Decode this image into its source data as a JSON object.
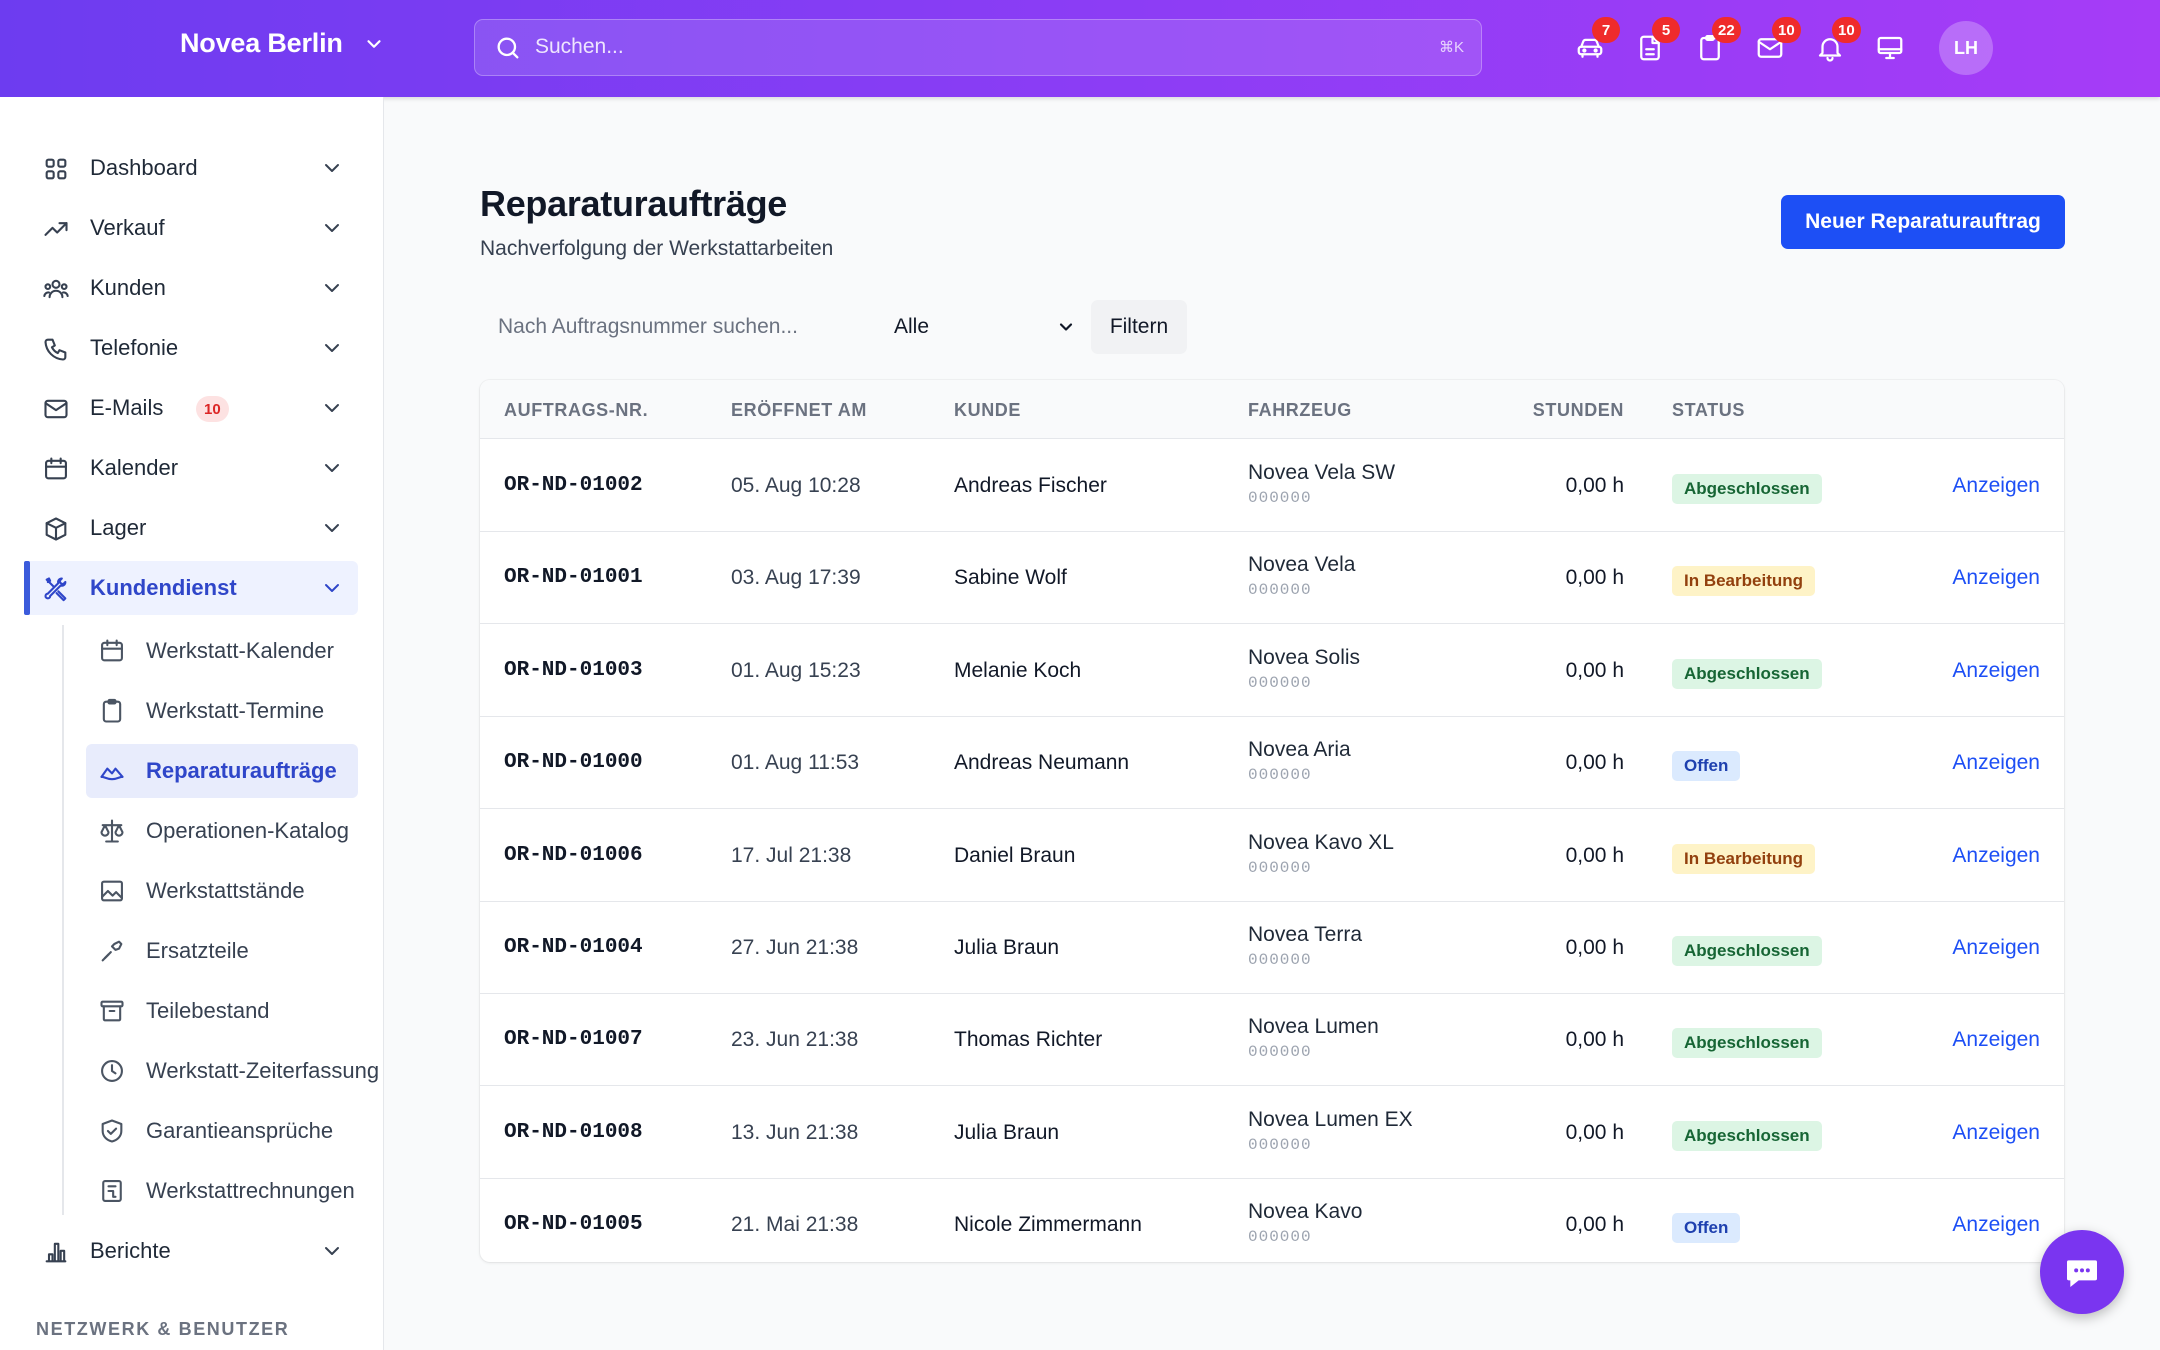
{
  "header": {
    "brand": "Novea Berlin",
    "search_placeholder": "Suchen...",
    "search_shortcut": "⌘K",
    "icons": [
      {
        "name": "car-icon",
        "badge": "7"
      },
      {
        "name": "document-icon",
        "badge": "5"
      },
      {
        "name": "clipboard-icon",
        "badge": "22"
      },
      {
        "name": "mail-icon",
        "badge": "10"
      },
      {
        "name": "bell-icon",
        "badge": "10"
      },
      {
        "name": "monitor-icon",
        "badge": ""
      }
    ],
    "avatar_initials": "LH"
  },
  "sidebar": {
    "items": [
      {
        "label": "Dashboard",
        "icon": "grid-icon"
      },
      {
        "label": "Verkauf",
        "icon": "trending-up-icon"
      },
      {
        "label": "Kunden",
        "icon": "users-icon"
      },
      {
        "label": "Telefonie",
        "icon": "phone-icon"
      },
      {
        "label": "E-Mails",
        "icon": "mail-icon",
        "badge": "10"
      },
      {
        "label": "Kalender",
        "icon": "calendar-icon"
      },
      {
        "label": "Lager",
        "icon": "box-icon"
      },
      {
        "label": "Kundendienst",
        "icon": "tools-icon",
        "active": true
      },
      {
        "label": "Berichte",
        "icon": "bar-chart-icon"
      }
    ],
    "subitems": [
      {
        "label": "Werkstatt-Kalender",
        "icon": "calendar-icon"
      },
      {
        "label": "Werkstatt-Termine",
        "icon": "clipboard-icon"
      },
      {
        "label": "Reparaturaufträge",
        "icon": "car-repair-icon",
        "active": true
      },
      {
        "label": "Operationen-Katalog",
        "icon": "scale-icon"
      },
      {
        "label": "Werkstattstände",
        "icon": "image-icon"
      },
      {
        "label": "Ersatzteile",
        "icon": "wrench-icon"
      },
      {
        "label": "Teilebestand",
        "icon": "archive-icon"
      },
      {
        "label": "Werkstatt-Zeiterfassung",
        "icon": "clock-icon"
      },
      {
        "label": "Garantieansprüche",
        "icon": "shield-icon"
      },
      {
        "label": "Werkstattrechnungen",
        "icon": "receipt-icon"
      }
    ],
    "section_title": "NETZWERK & BENUTZER"
  },
  "main": {
    "title": "Reparaturaufträge",
    "subtitle": "Nachverfolgung der Werkstattarbeiten",
    "new_button": "Neuer Reparaturauftrag",
    "filter": {
      "search_placeholder": "Nach Auftragsnummer suchen...",
      "select_value": "Alle",
      "button": "Filtern"
    },
    "table": {
      "columns": [
        "AUFTRAGS-NR.",
        "ERÖFFNET AM",
        "KUNDE",
        "FAHRZEUG",
        "STUNDEN",
        "STATUS"
      ],
      "action_label": "Anzeigen",
      "rows": [
        {
          "id": "OR-ND-01002",
          "opened": "05. Aug 10:28",
          "customer": "Andreas Fischer",
          "vehicle": "Novea Vela SW",
          "vin": "000000",
          "hours": "0,00 h",
          "status": "Abgeschlossen",
          "status_type": "done"
        },
        {
          "id": "OR-ND-01001",
          "opened": "03. Aug 17:39",
          "customer": "Sabine Wolf",
          "vehicle": "Novea Vela",
          "vin": "000000",
          "hours": "0,00 h",
          "status": "In Bearbeitung",
          "status_type": "prog"
        },
        {
          "id": "OR-ND-01003",
          "opened": "01. Aug 15:23",
          "customer": "Melanie Koch",
          "vehicle": "Novea Solis",
          "vin": "000000",
          "hours": "0,00 h",
          "status": "Abgeschlossen",
          "status_type": "done"
        },
        {
          "id": "OR-ND-01000",
          "opened": "01. Aug 11:53",
          "customer": "Andreas Neumann",
          "vehicle": "Novea Aria",
          "vin": "000000",
          "hours": "0,00 h",
          "status": "Offen",
          "status_type": "open"
        },
        {
          "id": "OR-ND-01006",
          "opened": "17. Jul 21:38",
          "customer": "Daniel Braun",
          "vehicle": "Novea Kavo XL",
          "vin": "000000",
          "hours": "0,00 h",
          "status": "In Bearbeitung",
          "status_type": "prog"
        },
        {
          "id": "OR-ND-01004",
          "opened": "27. Jun 21:38",
          "customer": "Julia Braun",
          "vehicle": "Novea Terra",
          "vin": "000000",
          "hours": "0,00 h",
          "status": "Abgeschlossen",
          "status_type": "done"
        },
        {
          "id": "OR-ND-01007",
          "opened": "23. Jun 21:38",
          "customer": "Thomas Richter",
          "vehicle": "Novea Lumen",
          "vin": "000000",
          "hours": "0,00 h",
          "status": "Abgeschlossen",
          "status_type": "done"
        },
        {
          "id": "OR-ND-01008",
          "opened": "13. Jun 21:38",
          "customer": "Julia Braun",
          "vehicle": "Novea Lumen EX",
          "vin": "000000",
          "hours": "0,00 h",
          "status": "Abgeschlossen",
          "status_type": "done"
        },
        {
          "id": "OR-ND-01005",
          "opened": "21. Mai 21:38",
          "customer": "Nicole Zimmermann",
          "vehicle": "Novea Kavo",
          "vin": "000000",
          "hours": "0,00 h",
          "status": "Offen",
          "status_type": "open"
        }
      ]
    }
  },
  "colors": {
    "header_gradient_start": "#6d3cf0",
    "header_gradient_end": "#a63cf7",
    "primary": "#1d4ff5",
    "active_nav": "#2f46c9",
    "badge_red": "#ef2b2b",
    "chat_fab": "#7a35f0"
  }
}
